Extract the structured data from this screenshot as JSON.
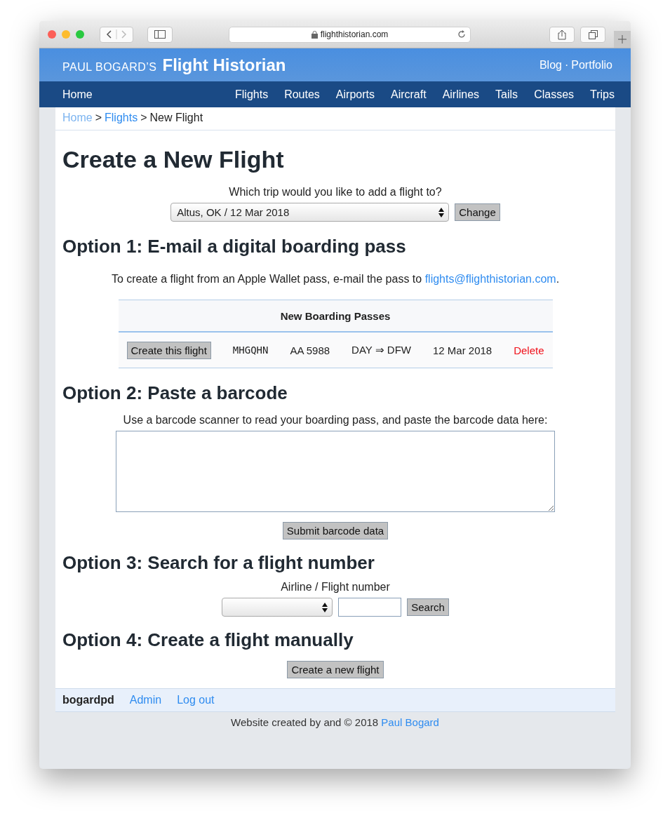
{
  "browser": {
    "url": "flighthistorian.com"
  },
  "header": {
    "brand_small": "PAUL BOGARD’S",
    "brand": "Flight Historian",
    "links": [
      "Blog",
      "Portfolio"
    ],
    "separator": "·"
  },
  "nav": {
    "home": "Home",
    "items": [
      "Flights",
      "Routes",
      "Airports",
      "Aircraft",
      "Airlines",
      "Tails",
      "Classes",
      "Trips"
    ]
  },
  "breadcrumb": {
    "items": [
      {
        "label": "Home",
        "visited": true
      },
      {
        "label": "Flights",
        "visited": false
      }
    ],
    "separator": ">",
    "current": "New Flight"
  },
  "title": "Create a New Flight",
  "trip": {
    "prompt": "Which trip would you like to add a flight to?",
    "value": "Altus, OK / 12 Mar 2018",
    "button": "Change"
  },
  "option1": {
    "heading": "Option 1: E-mail a digital boarding pass",
    "text": "To create a flight from an Apple Wallet pass, e-mail the pass to",
    "email": "flights@flighthistorian.com",
    "after": "."
  },
  "passes": {
    "title": "New Boarding Passes",
    "rows": [
      {
        "button": "Create this flight",
        "code": "MHGQHN",
        "flight": "AA 5988",
        "route": "DAY ⇒ DFW",
        "date": "12 Mar 2018",
        "delete": "Delete"
      }
    ]
  },
  "option2": {
    "heading": "Option 2: Paste a barcode",
    "prompt": "Use a barcode scanner to read your boarding pass, and paste the barcode data here:",
    "button": "Submit barcode data"
  },
  "option3": {
    "heading": "Option 3: Search for a flight number",
    "label": "Airline / Flight number",
    "button": "Search"
  },
  "option4": {
    "heading": "Option 4: Create a flight manually",
    "button": "Create a new flight"
  },
  "user_bar": {
    "user": "bogardpd",
    "links": [
      "Admin",
      "Log out"
    ]
  },
  "footer": {
    "text": "Website created by and © 2018",
    "link": "Paul Bogard"
  }
}
